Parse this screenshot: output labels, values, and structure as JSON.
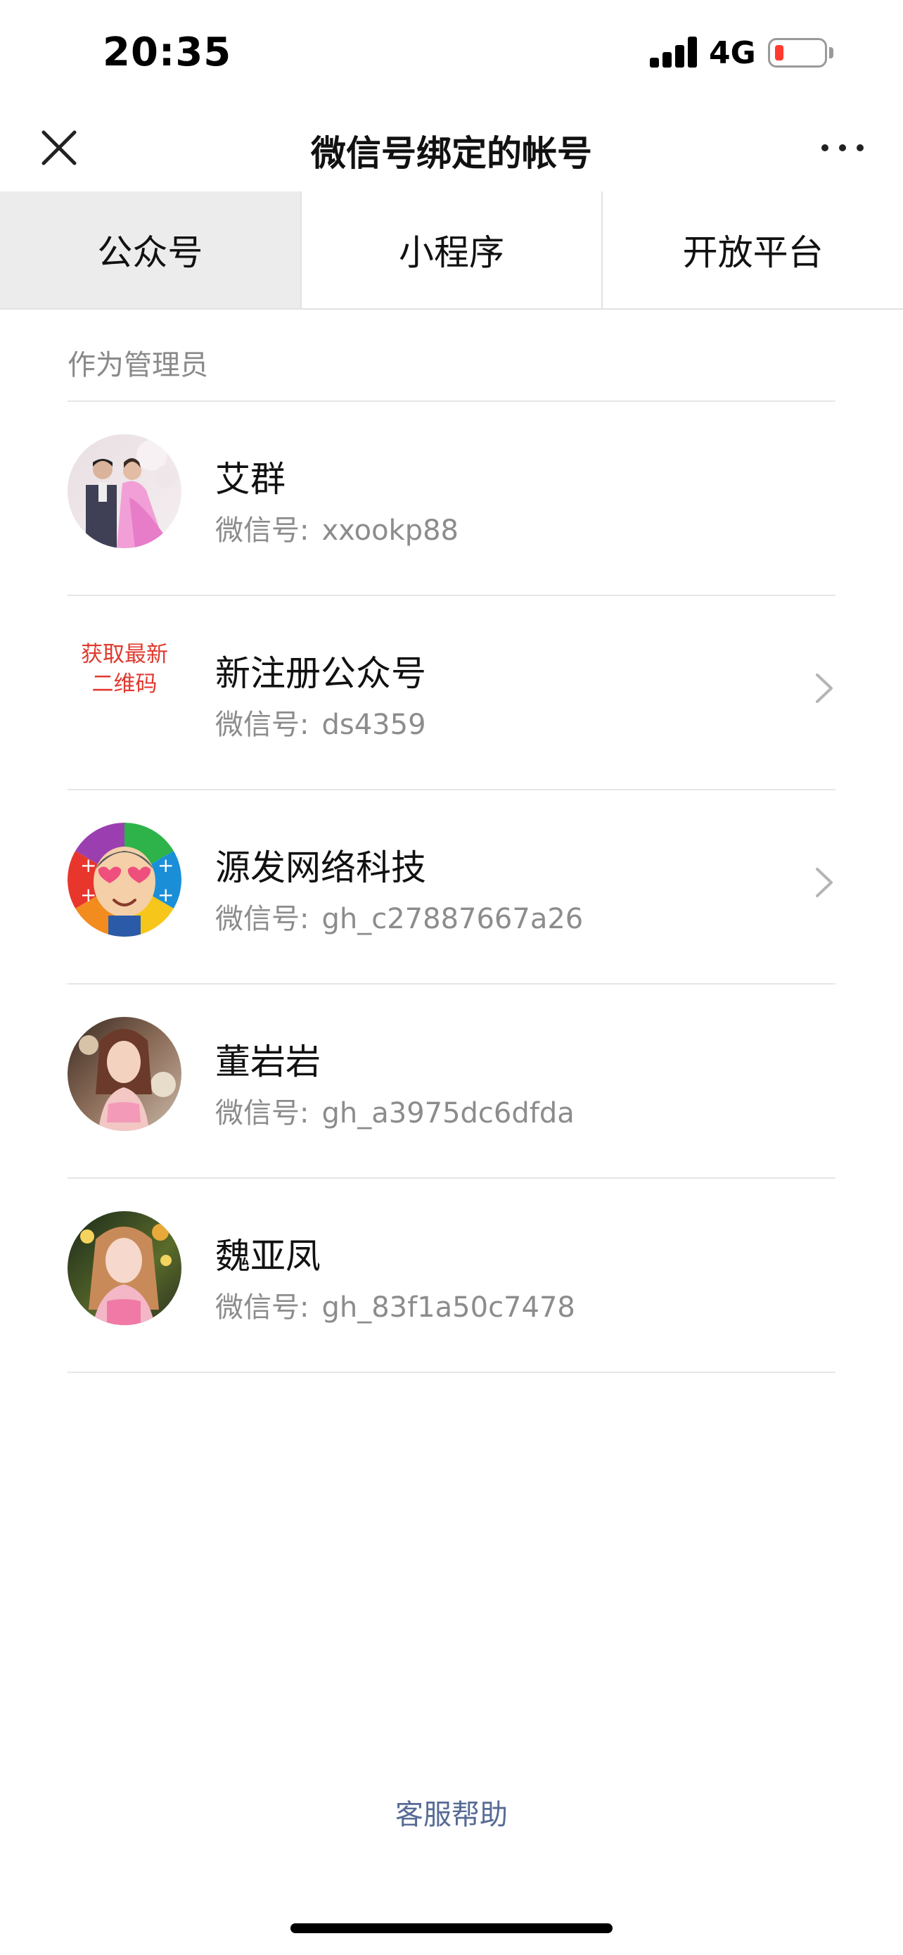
{
  "status_bar": {
    "time": "20:35",
    "network": "4G",
    "icons": [
      "signal-icon",
      "battery-low-icon"
    ]
  },
  "nav": {
    "title": "微信号绑定的帐号",
    "icons": [
      "close-icon",
      "more-icon"
    ]
  },
  "tabs": [
    {
      "label": "公众号",
      "active": true
    },
    {
      "label": "小程序",
      "active": false
    },
    {
      "label": "开放平台",
      "active": false
    }
  ],
  "section": {
    "title": "作为管理员"
  },
  "id_label": "微信号:",
  "accounts": [
    {
      "name": "艾群",
      "wechat_id": "xxookp88",
      "avatar": "wedding-photo-avatar",
      "has_chevron": false
    },
    {
      "name": "新注册公众号",
      "wechat_id": "ds4359",
      "avatar_text": "获取最新二维码",
      "avatar_text_line1": "获取最新",
      "avatar_text_line2": "二维码",
      "has_chevron": true
    },
    {
      "name": "源发网络科技",
      "wechat_id": "gh_c27887667a26",
      "avatar": "cartoon-face-avatar",
      "has_chevron": true
    },
    {
      "name": "董岩岩",
      "wechat_id": "gh_a3975dc6dfda",
      "avatar": "portrait-photo-avatar",
      "has_chevron": false
    },
    {
      "name": "魏亚凤",
      "wechat_id": "gh_83f1a50c7478",
      "avatar": "portrait-photo-avatar",
      "has_chevron": false
    }
  ],
  "footer": {
    "help_link": "客服帮助"
  },
  "colors": {
    "accent_link": "#576b95",
    "qr_text": "#e03a2f",
    "active_tab_bg": "#ececec",
    "battery_low": "#ff3b30"
  }
}
